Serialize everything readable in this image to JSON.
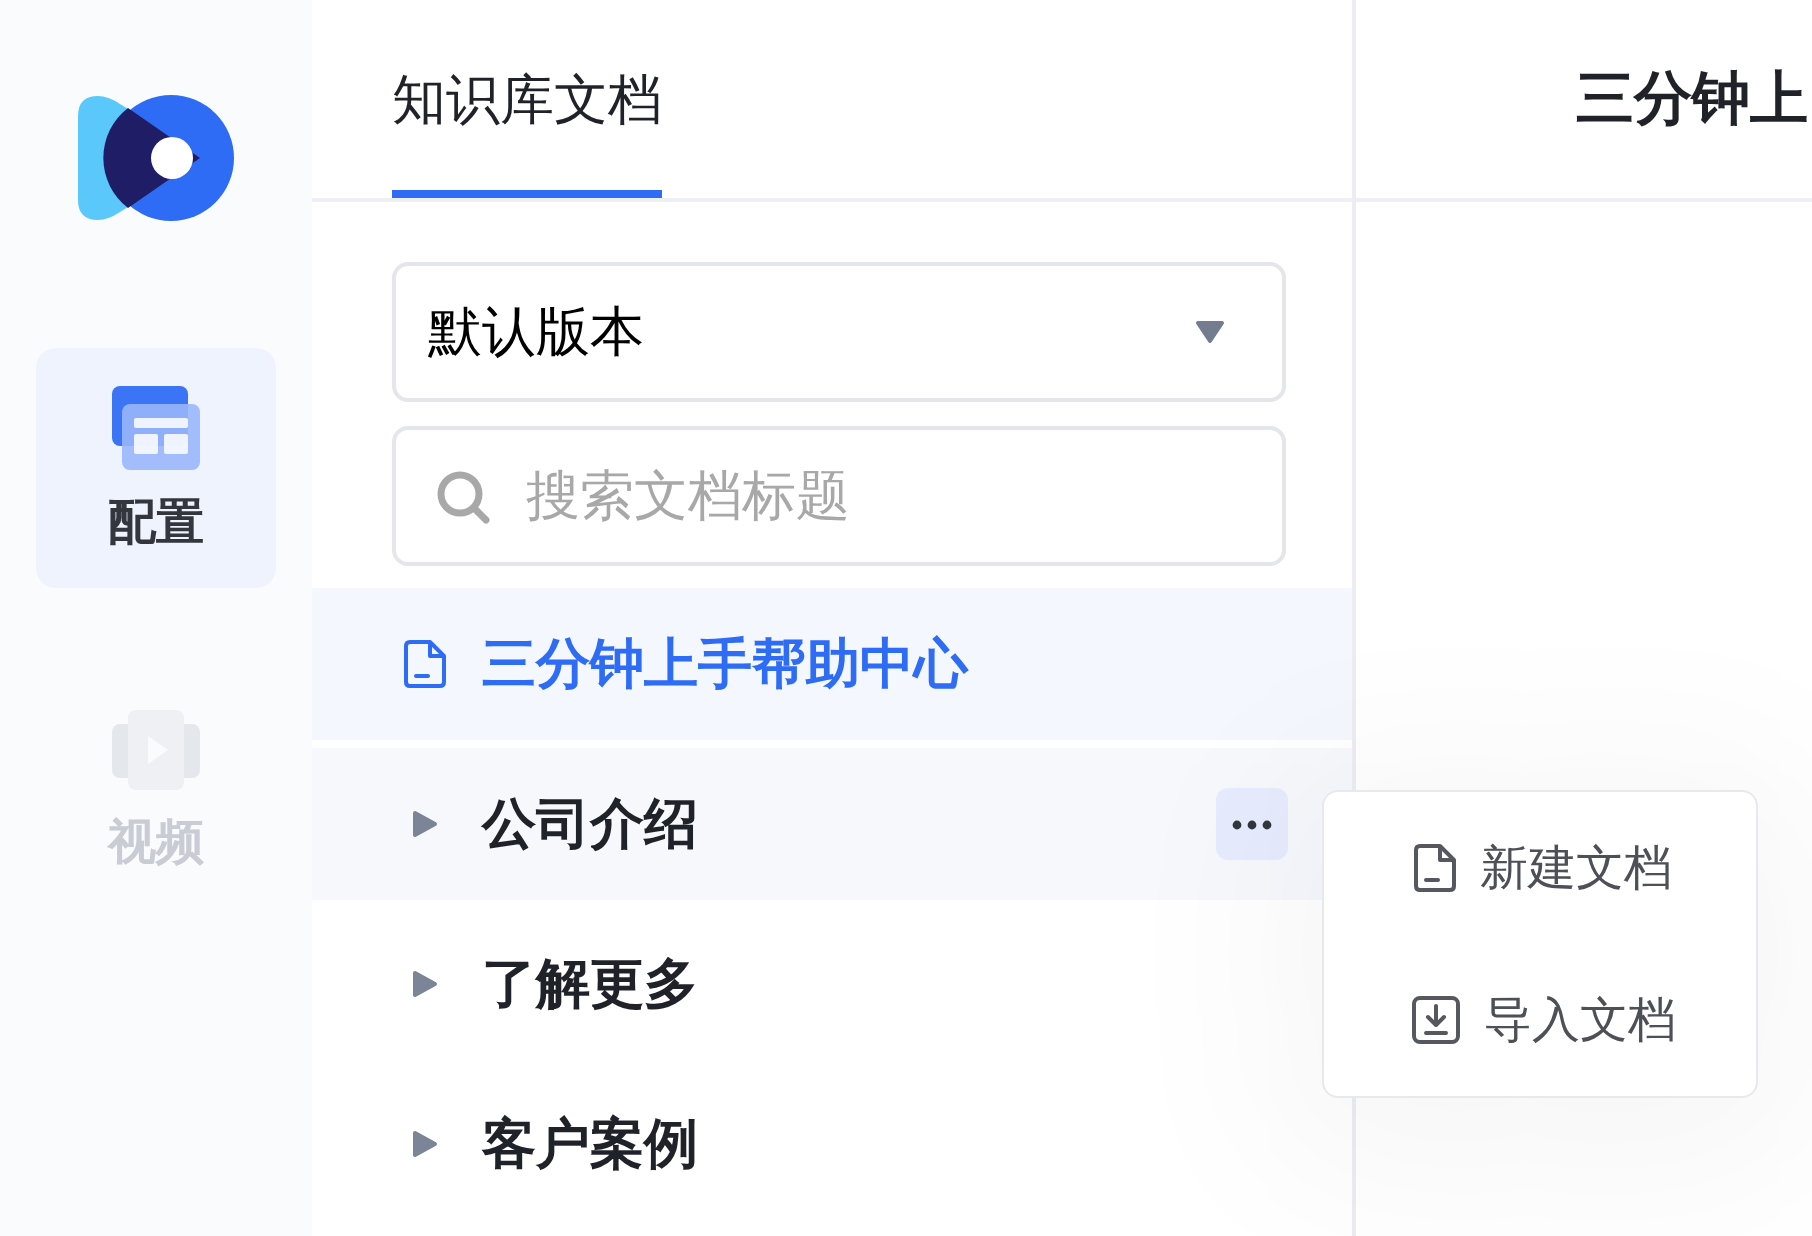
{
  "rail": {
    "items": [
      {
        "label": "配置",
        "kind": "config",
        "selected": true,
        "disabled": false
      },
      {
        "label": "视频",
        "kind": "video",
        "selected": false,
        "disabled": true
      }
    ]
  },
  "tabs": [
    {
      "label": "知识库文档",
      "selected": true
    }
  ],
  "version_select": {
    "value": "默认版本"
  },
  "search": {
    "placeholder": "搜索文档标题"
  },
  "tree": [
    {
      "label": "三分钟上手帮助中心",
      "kind": "document",
      "selected": true,
      "hovered": false
    },
    {
      "label": "公司介绍",
      "kind": "folder",
      "selected": false,
      "hovered": true,
      "expanded": false
    },
    {
      "label": "了解更多",
      "kind": "folder",
      "selected": false,
      "hovered": false,
      "expanded": false
    },
    {
      "label": "客户案例",
      "kind": "folder",
      "selected": false,
      "hovered": false,
      "expanded": false
    }
  ],
  "document": {
    "title": "三分钟上"
  },
  "context_menu": {
    "items": [
      {
        "label": "新建文档",
        "kind": "new"
      },
      {
        "label": "导入文档",
        "kind": "import"
      }
    ]
  }
}
